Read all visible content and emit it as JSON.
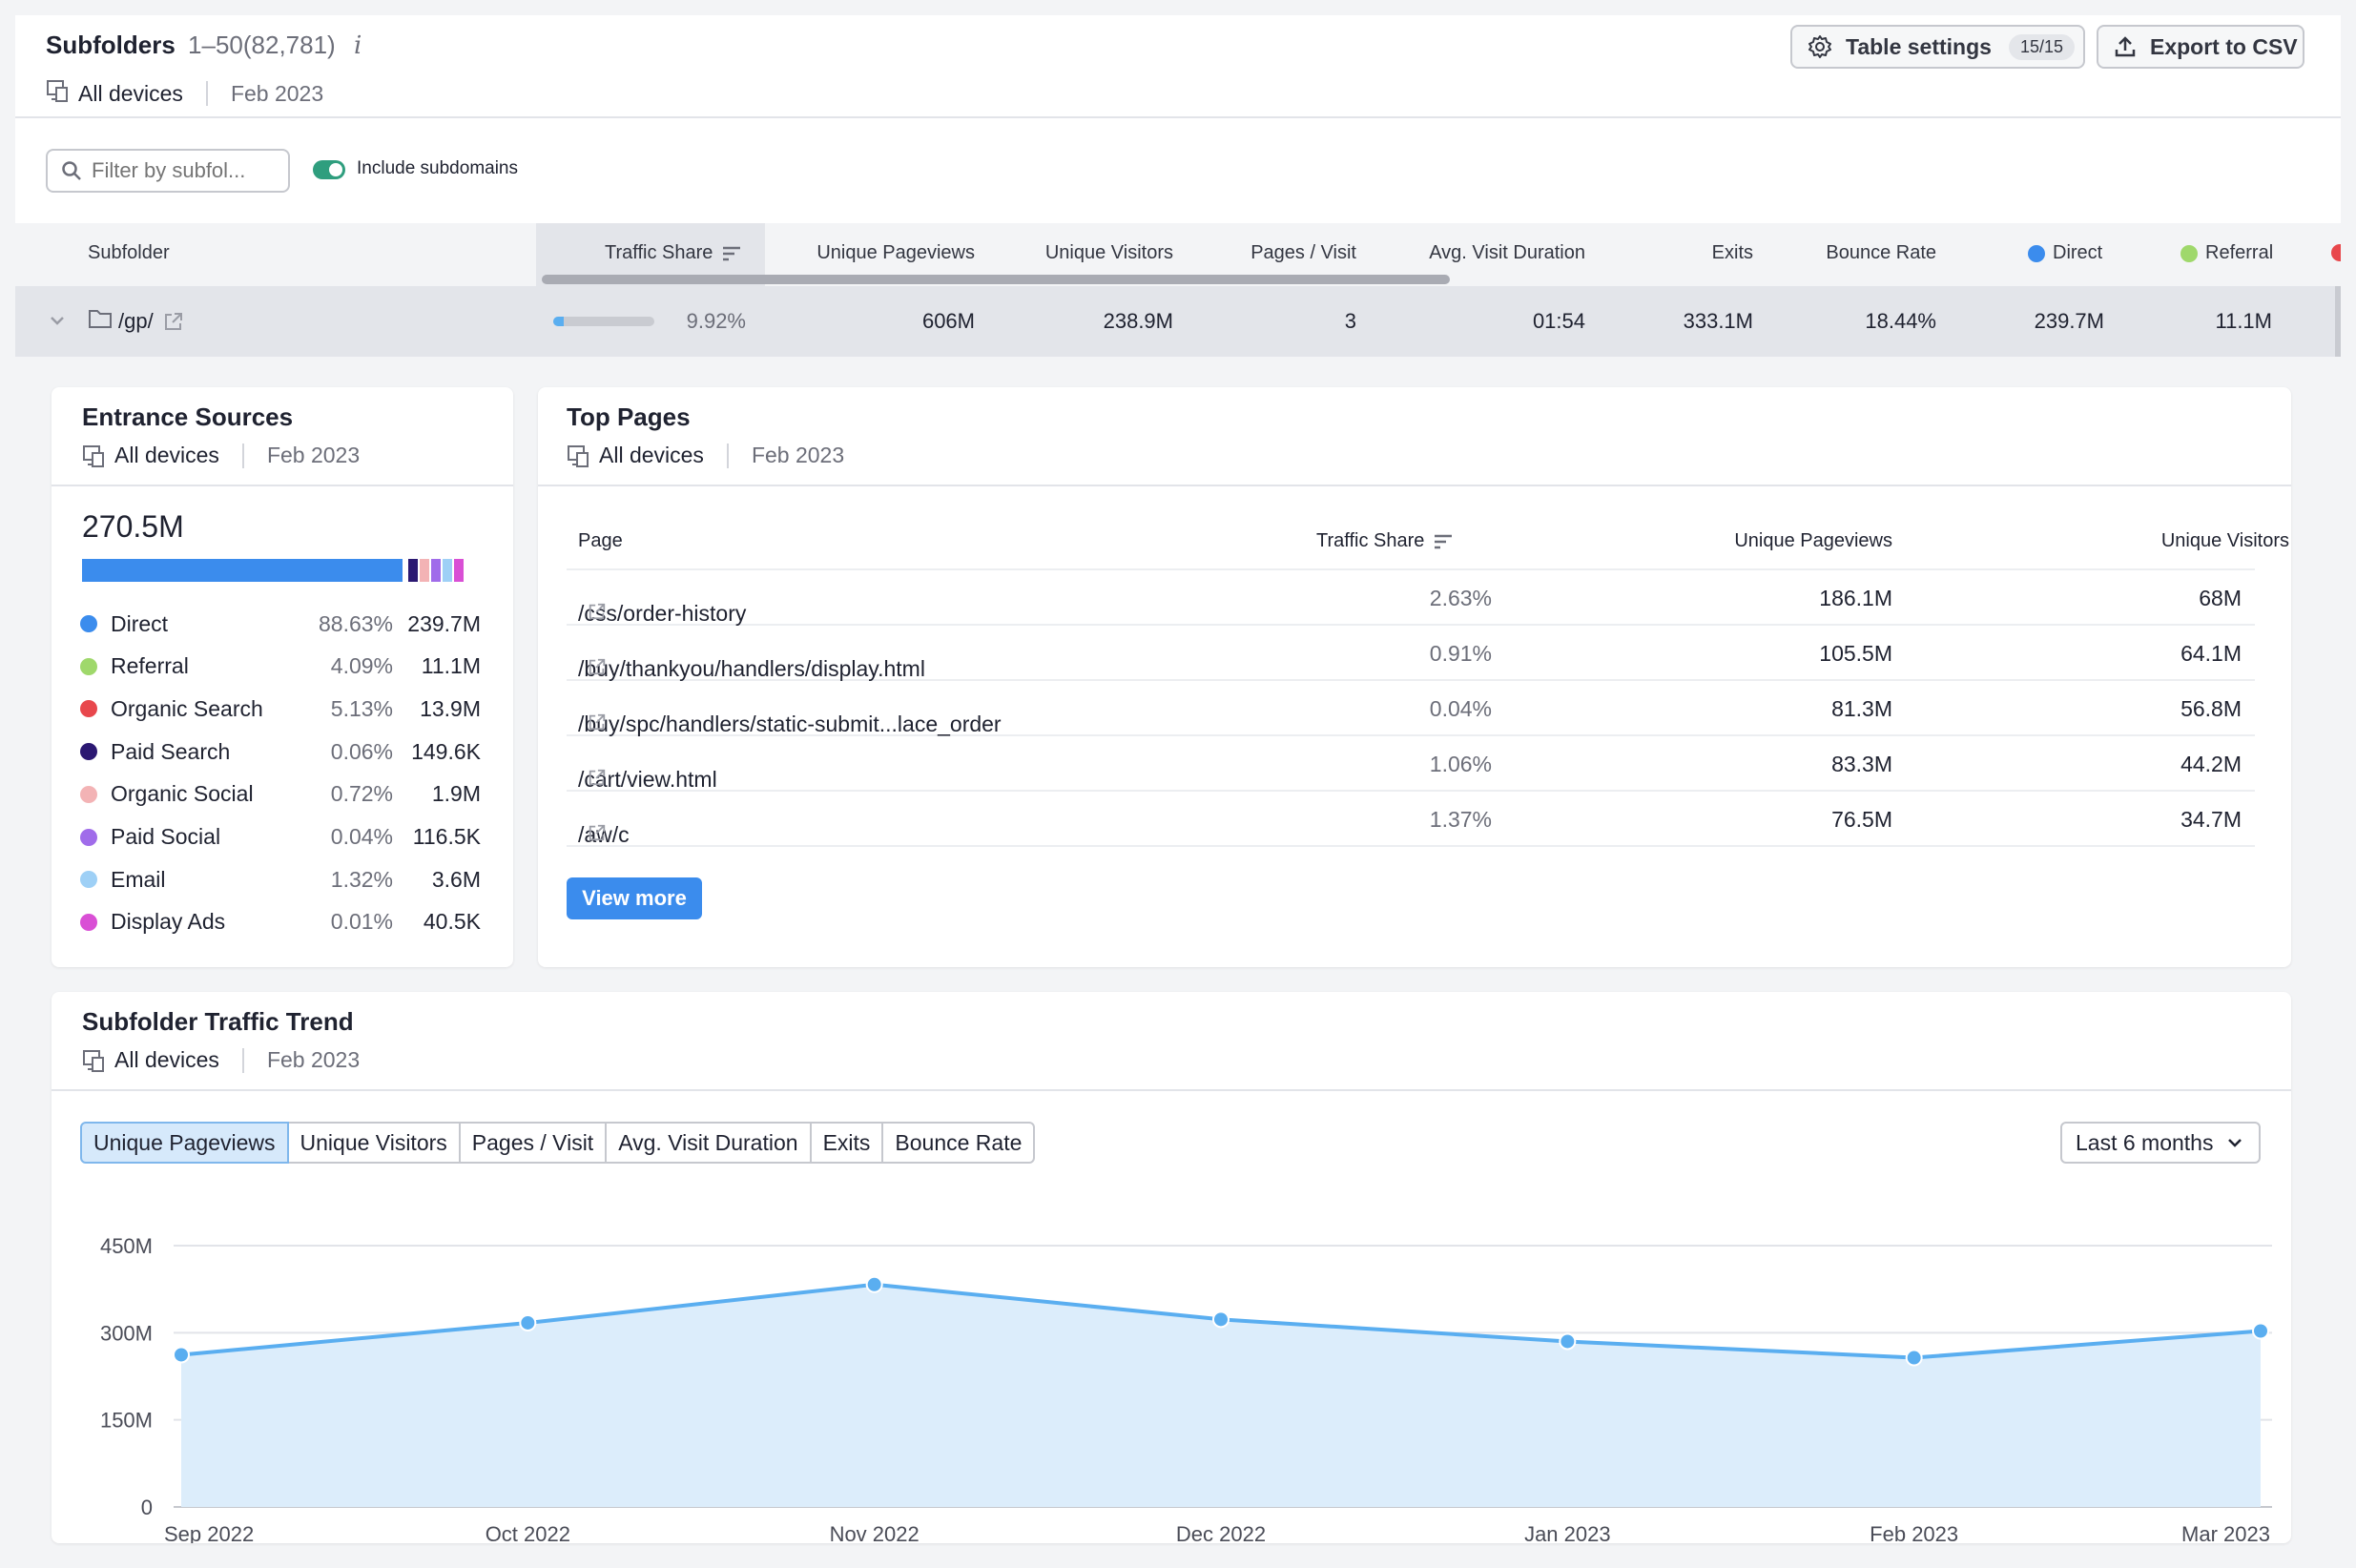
{
  "header": {
    "title": "Subfolders",
    "range": "1–50(82,781)",
    "info_glyph": "i",
    "devices": "All devices",
    "date": "Feb 2023",
    "table_settings_label": "Table settings",
    "table_settings_badge": "15/15",
    "export_label": "Export to CSV"
  },
  "filter": {
    "placeholder": "Filter by subfol...",
    "include_subdomains_label": "Include subdomains",
    "include_subdomains_on": true
  },
  "table": {
    "columns": {
      "subfolder": "Subfolder",
      "traffic_share": "Traffic Share",
      "unique_pageviews": "Unique Pageviews",
      "unique_visitors": "Unique Visitors",
      "pages_visit": "Pages / Visit",
      "avg_duration": "Avg. Visit Duration",
      "exits": "Exits",
      "bounce_rate": "Bounce Rate",
      "direct": "Direct",
      "referral": "Referral"
    },
    "row": {
      "subfolder": "/gp/",
      "traffic_share": "9.92%",
      "traffic_share_fraction": 0.0992,
      "unique_pageviews": "606M",
      "unique_visitors": "238.9M",
      "pages_visit": "3",
      "avg_duration": "01:54",
      "exits": "333.1M",
      "bounce_rate": "18.44%",
      "direct": "239.7M",
      "referral": "11.1M"
    },
    "colors": {
      "direct": "#3b8ced",
      "referral": "#9fd86b",
      "next": "#e8474c"
    }
  },
  "entrance_sources": {
    "title": "Entrance Sources",
    "devices": "All devices",
    "date": "Feb 2023",
    "total": "270.5M",
    "items": [
      {
        "label": "Direct",
        "pct": "88.63%",
        "value": "239.7M",
        "color": "#3b8ced"
      },
      {
        "label": "Referral",
        "pct": "4.09%",
        "value": "11.1M",
        "color": "#9fd86b"
      },
      {
        "label": "Organic Search",
        "pct": "5.13%",
        "value": "13.9M",
        "color": "#e8474c"
      },
      {
        "label": "Paid Search",
        "pct": "0.06%",
        "value": "149.6K",
        "color": "#2b1872"
      },
      {
        "label": "Organic Social",
        "pct": "0.72%",
        "value": "1.9M",
        "color": "#f3b3b5"
      },
      {
        "label": "Paid Social",
        "pct": "0.04%",
        "value": "116.5K",
        "color": "#a06cea"
      },
      {
        "label": "Email",
        "pct": "1.32%",
        "value": "3.6M",
        "color": "#9ed0f6"
      },
      {
        "label": "Display Ads",
        "pct": "0.01%",
        "value": "40.5K",
        "color": "#d94fd5"
      }
    ]
  },
  "top_pages": {
    "title": "Top Pages",
    "devices": "All devices",
    "date": "Feb 2023",
    "columns": {
      "page": "Page",
      "traffic_share": "Traffic Share",
      "unique_pageviews": "Unique Pageviews",
      "unique_visitors": "Unique Visitors"
    },
    "rows": [
      {
        "page": "/css/order-history",
        "traffic_share": "2.63%",
        "unique_pageviews": "186.1M",
        "unique_visitors": "68M"
      },
      {
        "page": "/buy/thankyou/handlers/display.html",
        "traffic_share": "0.91%",
        "unique_pageviews": "105.5M",
        "unique_visitors": "64.1M"
      },
      {
        "page": "/buy/spc/handlers/static-submit...lace_order",
        "traffic_share": "0.04%",
        "unique_pageviews": "81.3M",
        "unique_visitors": "56.8M"
      },
      {
        "page": "/cart/view.html",
        "traffic_share": "1.06%",
        "unique_pageviews": "83.3M",
        "unique_visitors": "44.2M"
      },
      {
        "page": "/aw/c",
        "traffic_share": "1.37%",
        "unique_pageviews": "76.5M",
        "unique_visitors": "34.7M"
      }
    ],
    "view_more_label": "View more",
    "accent": "#3b8ced"
  },
  "trend": {
    "title": "Subfolder Traffic Trend",
    "devices": "All devices",
    "date": "Feb 2023",
    "tabs": [
      "Unique Pageviews",
      "Unique Visitors",
      "Pages / Visit",
      "Avg. Visit Duration",
      "Exits",
      "Bounce Rate"
    ],
    "active_tab": "Unique Pageviews",
    "period_label": "Last 6 months",
    "chart_data": {
      "type": "area",
      "x": [
        "Sep 2022",
        "Oct 2022",
        "Nov 2022",
        "Dec 2022",
        "Jan 2023",
        "Feb 2023",
        "Mar 2023"
      ],
      "series": [
        {
          "values": [
            262,
            317,
            383,
            323,
            285,
            257,
            303
          ],
          "color": "#5aaef0"
        }
      ],
      "yticks": [
        "450M",
        "300M",
        "150M",
        "0"
      ],
      "ylim": [
        0,
        450
      ],
      "unit": "M",
      "grid": true
    }
  }
}
